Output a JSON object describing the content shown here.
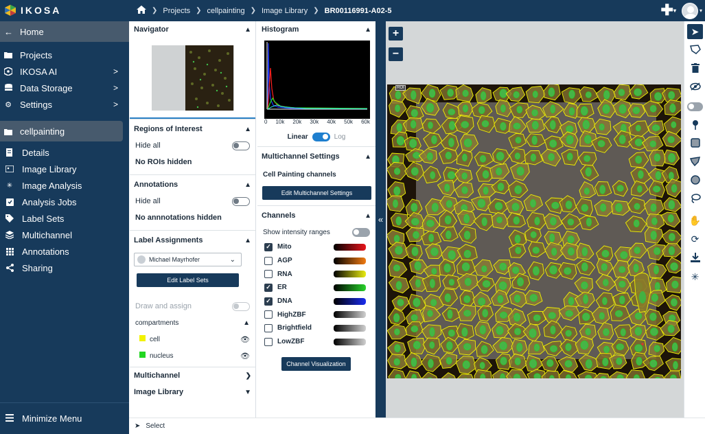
{
  "app": {
    "logo_text": "IKOSA"
  },
  "breadcrumb": [
    "Projects",
    "cellpainting",
    "Image Library",
    "BR00116991-A02-5"
  ],
  "sidebar": {
    "home_label": "Home",
    "items": [
      {
        "label": "Projects",
        "icon": "folder-icon"
      },
      {
        "label": "IKOSA AI",
        "icon": "ai-icon",
        "chevron": ">"
      },
      {
        "label": "Data Storage",
        "icon": "database-icon",
        "chevron": ">"
      },
      {
        "label": "Settings",
        "icon": "gear-icon",
        "chevron": ">"
      }
    ],
    "project": "cellpainting",
    "project_items": [
      {
        "label": "Details",
        "icon": "details-icon"
      },
      {
        "label": "Image Library",
        "icon": "images-icon"
      },
      {
        "label": "Image Analysis",
        "icon": "analysis-icon"
      },
      {
        "label": "Analysis Jobs",
        "icon": "jobs-icon"
      },
      {
        "label": "Label Sets",
        "icon": "tag-icon"
      },
      {
        "label": "Multichannel",
        "icon": "layers-icon"
      },
      {
        "label": "Annotations",
        "icon": "grid-icon"
      },
      {
        "label": "Sharing",
        "icon": "share-icon"
      }
    ],
    "minimize_label": "Minimize Menu"
  },
  "col1": {
    "navigator_title": "Navigator",
    "roi_title": "Regions of Interest",
    "roi_hide_all": "Hide all",
    "roi_status": "No ROIs hidden",
    "annotations_title": "Annotations",
    "ann_hide_all": "Hide all",
    "ann_status": "No annnotations hidden",
    "label_title": "Label Assignments",
    "user": "Michael Mayrhofer",
    "edit_label_sets": "Edit Label Sets",
    "draw_assign": "Draw and assign",
    "compartments": "compartments",
    "labels": [
      {
        "name": "cell",
        "color": "#f2f200"
      },
      {
        "name": "nucleus",
        "color": "#22d622"
      }
    ],
    "multichannel_title": "Multichannel",
    "image_library_title": "Image Library"
  },
  "col2": {
    "histogram_title": "Histogram",
    "hist_ticks": [
      "0",
      "10k",
      "20k",
      "30k",
      "40k",
      "50k",
      "60k"
    ],
    "linear": "Linear",
    "log": "Log",
    "multichannel_title": "Multichannel Settings",
    "channels_preset": "Cell Painting channels",
    "edit_multichannel": "Edit Multichannel Settings",
    "channels_title": "Channels",
    "show_ranges": "Show intensity ranges",
    "channels": [
      {
        "name": "Mito",
        "checked": true,
        "color": "#e8141c"
      },
      {
        "name": "AGP",
        "checked": false,
        "color": "#f07a12"
      },
      {
        "name": "RNA",
        "checked": false,
        "color": "#e8ea10"
      },
      {
        "name": "ER",
        "checked": true,
        "color": "#28d22a"
      },
      {
        "name": "DNA",
        "checked": true,
        "color": "#1a2cf0"
      },
      {
        "name": "HighZBF",
        "checked": false,
        "color": "#d0d0d0"
      },
      {
        "name": "Brightfield",
        "checked": false,
        "color": "#d0d0d0"
      },
      {
        "name": "LowZBF",
        "checked": false,
        "color": "#d0d0d0"
      }
    ],
    "channel_viz": "Channel Visualization"
  },
  "viewer": {
    "roi_tag": "ROI"
  },
  "status": {
    "tool": "Select"
  },
  "colors": {
    "navy": "#173a5b",
    "accent": "#1e7fcf"
  }
}
